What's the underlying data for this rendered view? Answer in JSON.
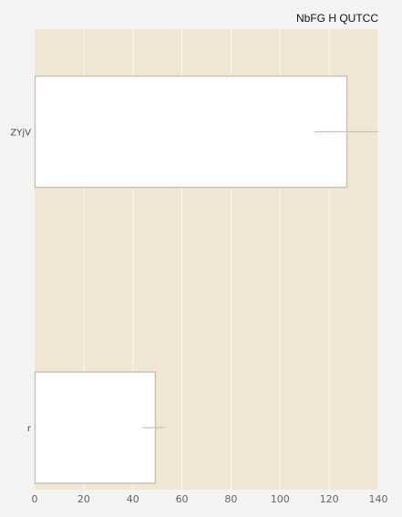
{
  "chart_data": {
    "type": "bar",
    "orientation": "horizontal",
    "title": "NbFG H  QUTCC",
    "xlabel": "",
    "ylabel": "",
    "categories": [
      "ZYjV",
      "r"
    ],
    "values": [
      127,
      49
    ],
    "error_low": [
      114,
      44
    ],
    "error_high": [
      140,
      53
    ],
    "xlim": [
      0,
      140
    ],
    "xticks": [
      0,
      20,
      40,
      60,
      80,
      100,
      120,
      140
    ],
    "xtick_labels": [
      "0",
      "20",
      "40",
      "60",
      "80",
      "100",
      "120",
      "140"
    ],
    "grid": true,
    "colors": {
      "background": "#f3f3f3",
      "plot_background": "#efe6d4",
      "grid": "#fbf8f1",
      "bar_fill": "#ffffff",
      "bar_stroke": "#c9c2b6",
      "error_bar": "#c9c2b6"
    }
  }
}
